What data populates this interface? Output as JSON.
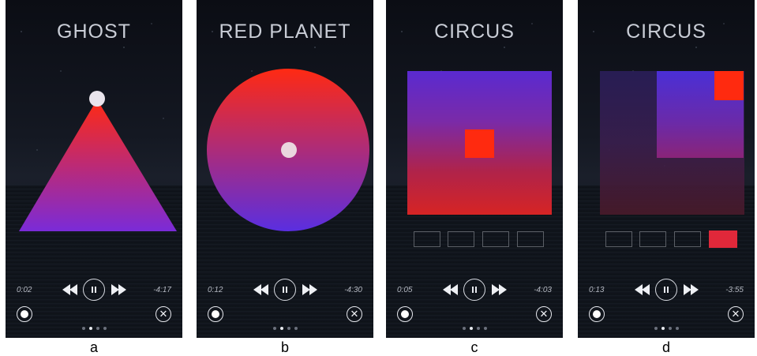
{
  "panels": [
    {
      "letter": "a",
      "title": "GHOST",
      "elapsed": "0:02",
      "remaining": "-4:17"
    },
    {
      "letter": "b",
      "title": "RED PLANET",
      "elapsed": "0:12",
      "remaining": "-4:30"
    },
    {
      "letter": "c",
      "title": "CIRCUS",
      "elapsed": "0:05",
      "remaining": "-4:03"
    },
    {
      "letter": "d",
      "title": "CIRCUS",
      "elapsed": "0:13",
      "remaining": "-3:55"
    }
  ],
  "colors": {
    "red": "#ff2a12",
    "violet": "#4a2fd6",
    "frame": "#5b5f66",
    "active_frame": "#e0283a"
  },
  "icons": [
    "rewind-icon",
    "pause-icon",
    "fast-forward-icon",
    "record-icon",
    "close-icon"
  ],
  "page_indicator": {
    "count": 4,
    "active_index": 1
  }
}
